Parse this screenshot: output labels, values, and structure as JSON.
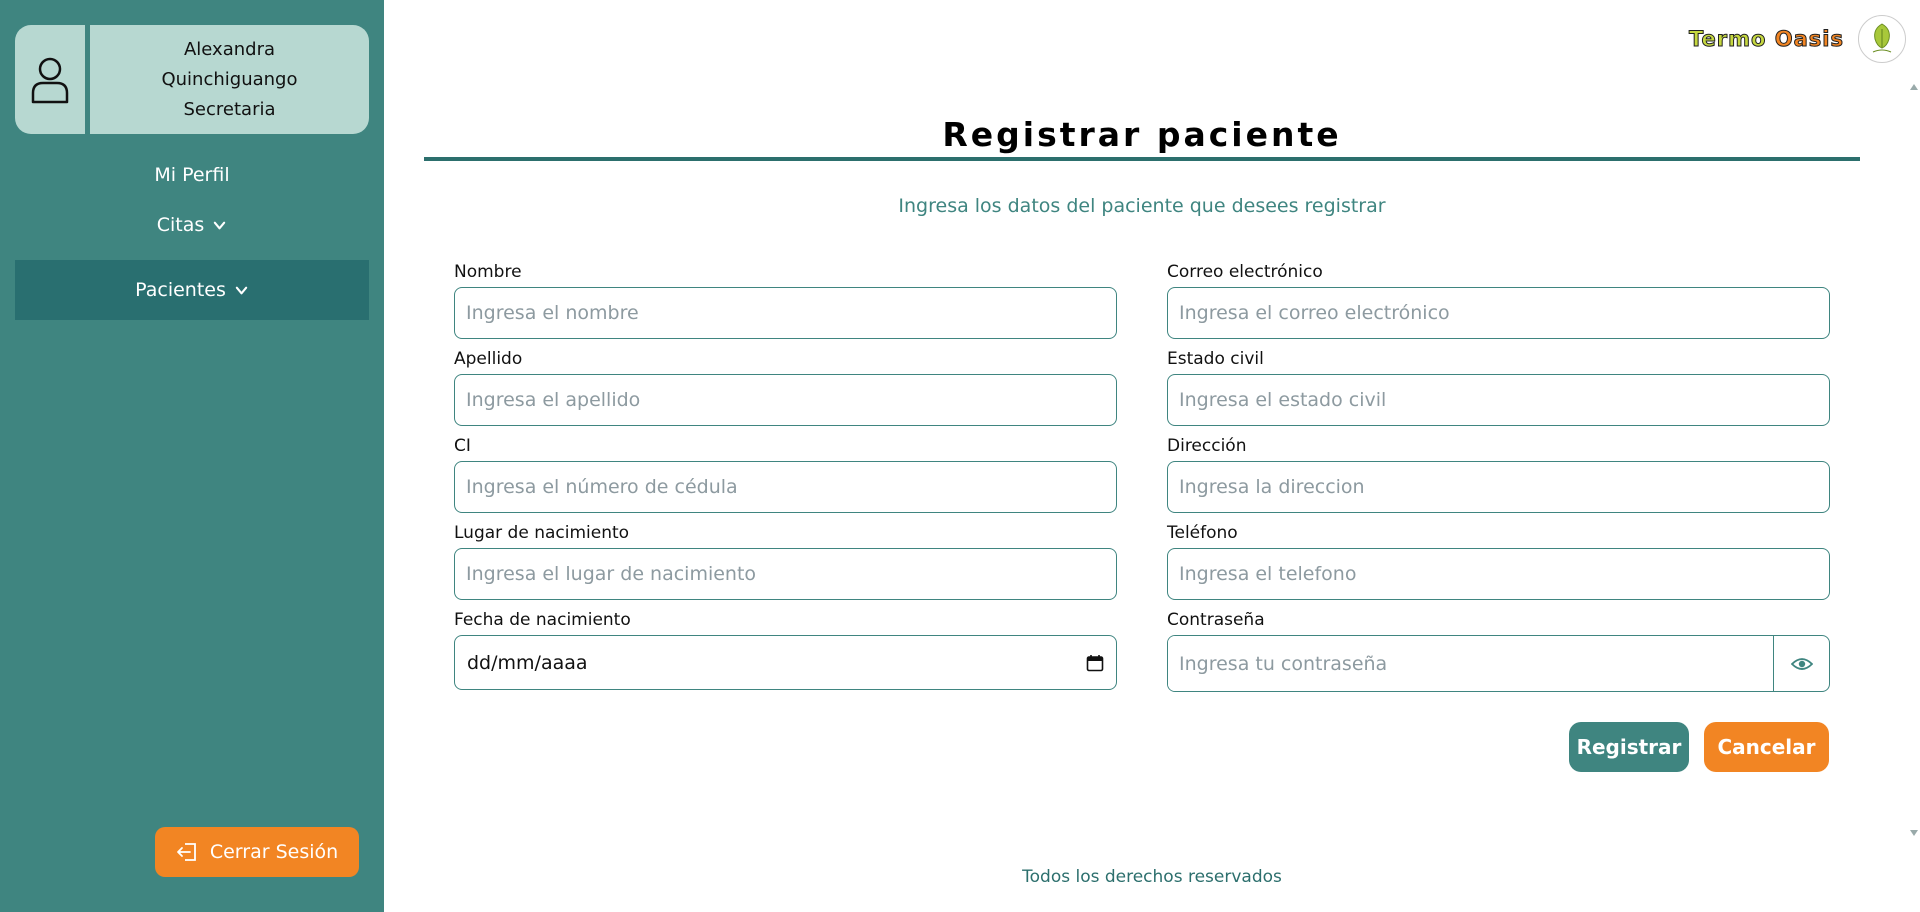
{
  "sidebar": {
    "user": {
      "first_name": "Alexandra",
      "last_name": "Quinchiguango",
      "role": "Secretaria"
    },
    "nav": {
      "perfil": "Mi Perfil",
      "citas": "Citas",
      "pacientes": "Pacientes"
    },
    "logout_label": "Cerrar Sesión"
  },
  "brand": {
    "termo": "Termo",
    "oasis": "Oasis"
  },
  "form": {
    "title": "Registrar paciente",
    "subtitle": "Ingresa los datos del paciente que desees registrar",
    "fields": {
      "nombre": {
        "label": "Nombre",
        "placeholder": "Ingresa el nombre"
      },
      "apellido": {
        "label": "Apellido",
        "placeholder": "Ingresa el apellido"
      },
      "ci": {
        "label": "CI",
        "placeholder": "Ingresa el número de cédula"
      },
      "lugar": {
        "label": "Lugar de nacimiento",
        "placeholder": "Ingresa el lugar de nacimiento"
      },
      "fecha": {
        "label": "Fecha de nacimiento",
        "value": "dd/mm/aaaa"
      },
      "correo": {
        "label": "Correo electrónico",
        "placeholder": "Ingresa el correo electrónico"
      },
      "estado": {
        "label": "Estado civil",
        "placeholder": "Ingresa el estado civil"
      },
      "direccion": {
        "label": "Dirección",
        "placeholder": "Ingresa la direccion"
      },
      "telefono": {
        "label": "Teléfono",
        "placeholder": "Ingresa el telefono"
      },
      "contrasena": {
        "label": "Contraseña",
        "placeholder": "Ingresa tu contraseña"
      }
    },
    "register_label": "Registrar",
    "cancel_label": "Cancelar"
  },
  "footer": "Todos los derechos reservados",
  "colors": {
    "sidebar": "#3f8580",
    "active_nav": "#296f70",
    "user_card": "#b7d8d1",
    "accent_orange": "#f28523"
  },
  "icons": [
    "user-icon",
    "chevron-down-icon",
    "logout-icon",
    "brand-logo-icon",
    "calendar-icon",
    "eye-icon"
  ]
}
